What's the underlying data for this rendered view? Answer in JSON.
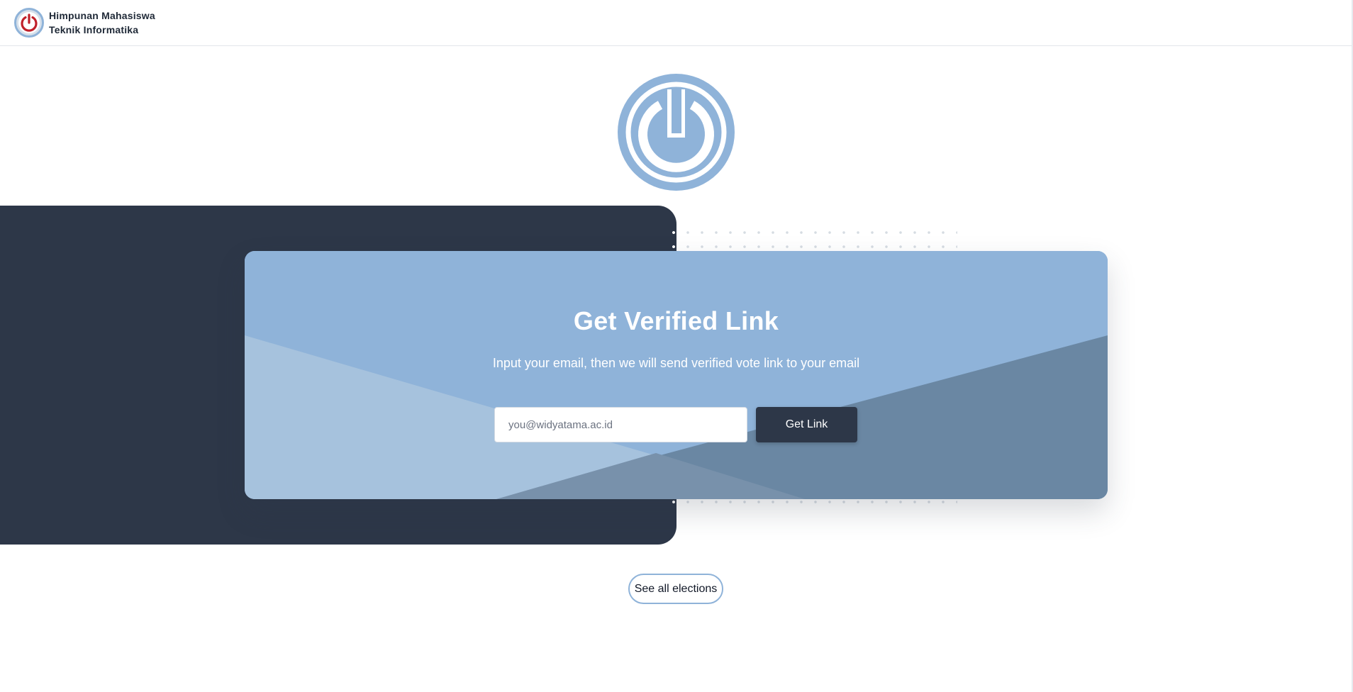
{
  "header": {
    "org_name_line1": "Himpunan Mahasiswa",
    "org_name_line2": "Teknik Informatika",
    "logo_icon": "power-icon"
  },
  "hero": {
    "logo_icon": "power-icon"
  },
  "verify_card": {
    "title": "Get Verified Link",
    "subtitle": "Input your email, then we will send verified vote link to your email",
    "email": {
      "value": "",
      "placeholder": "you@widyatama.ac.id"
    },
    "submit_label": "Get Link"
  },
  "footer": {
    "see_all_label": "See all elections"
  },
  "colors": {
    "accent_light_blue": "#8fb3d9",
    "dark_navy": "#2d3748",
    "logo_red": "#c0202a"
  }
}
